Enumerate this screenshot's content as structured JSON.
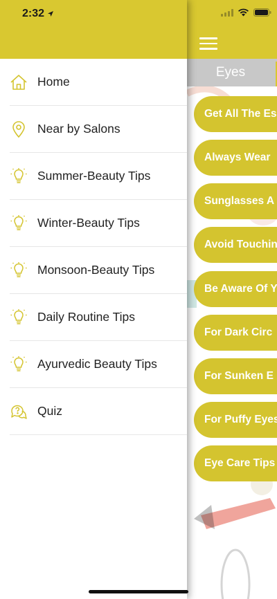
{
  "status_bar": {
    "time": "2:32"
  },
  "drawer": {
    "items": [
      {
        "label": "Home",
        "icon": "home-icon"
      },
      {
        "label": "Near by Salons",
        "icon": "location-pin-icon"
      },
      {
        "label": "Summer-Beauty Tips",
        "icon": "lightbulb-icon"
      },
      {
        "label": "Winter-Beauty Tips",
        "icon": "lightbulb-icon"
      },
      {
        "label": "Monsoon-Beauty Tips",
        "icon": "lightbulb-icon"
      },
      {
        "label": "Daily Routine Tips",
        "icon": "lightbulb-icon"
      },
      {
        "label": "Ayurvedic Beauty Tips",
        "icon": "lightbulb-icon"
      },
      {
        "label": "Quiz",
        "icon": "quiz-bubble-icon"
      }
    ]
  },
  "main": {
    "tabs": [
      {
        "label": "Eyes"
      }
    ],
    "tips": [
      {
        "label": "Get All The Es"
      },
      {
        "label": "Always Wear"
      },
      {
        "label": "Sunglasses A"
      },
      {
        "label": "Avoid Touchin"
      },
      {
        "label": "Be Aware Of Y"
      },
      {
        "label": "For Dark Circ"
      },
      {
        "label": "For Sunken E"
      },
      {
        "label": "For Puffy Eyes"
      },
      {
        "label": "Eye Care Tips"
      }
    ]
  },
  "colors": {
    "accent": "#d9c830",
    "pill": "#d4c42f",
    "tab_inactive": "#c8c8c8",
    "icon": "#d4c42f"
  }
}
